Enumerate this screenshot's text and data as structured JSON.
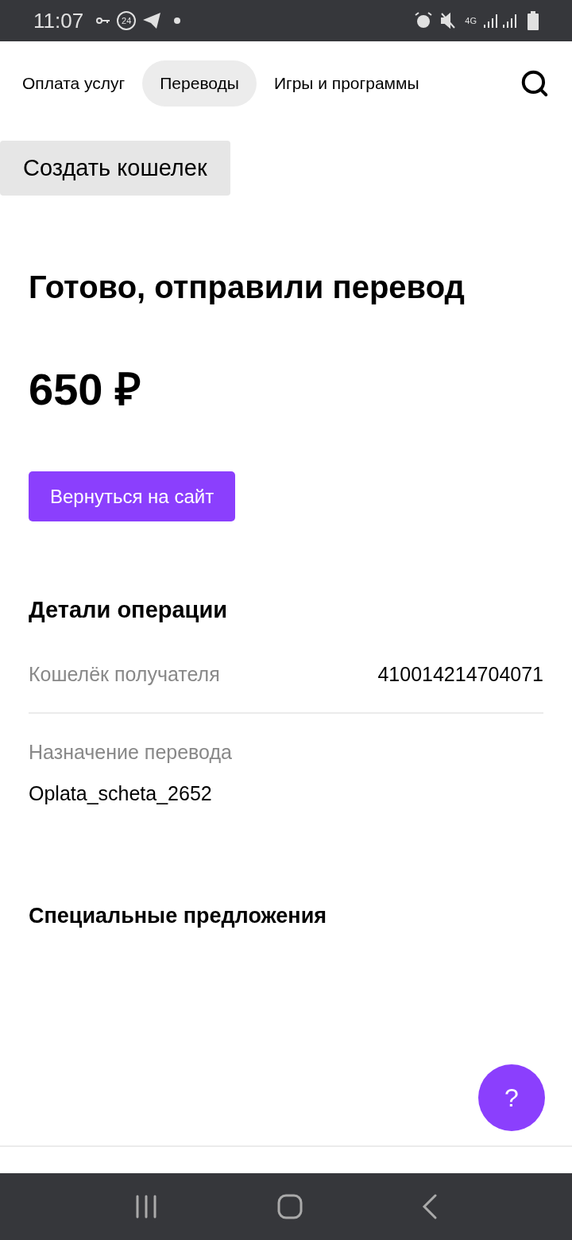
{
  "status_bar": {
    "time": "11:07",
    "badge": "24",
    "network": "4G"
  },
  "tabs": [
    {
      "label": "Оплата услуг",
      "selected": false
    },
    {
      "label": "Переводы",
      "selected": true
    },
    {
      "label": "Игры и программы",
      "selected": false
    }
  ],
  "create_wallet": "Создать кошелек",
  "title": "Готово, отправили перевод",
  "amount": "650 ₽",
  "back_button": "Вернуться на сайт",
  "details": {
    "title": "Детали операции",
    "rows": [
      {
        "kind": "inline",
        "label": "Кошелёк получателя",
        "value": "410014214704071"
      },
      {
        "kind": "stacked",
        "label": "Назначение перевода",
        "value": "Oplata_scheta_2652"
      }
    ]
  },
  "offers_title": "Специальные предложения",
  "help_button": "?"
}
